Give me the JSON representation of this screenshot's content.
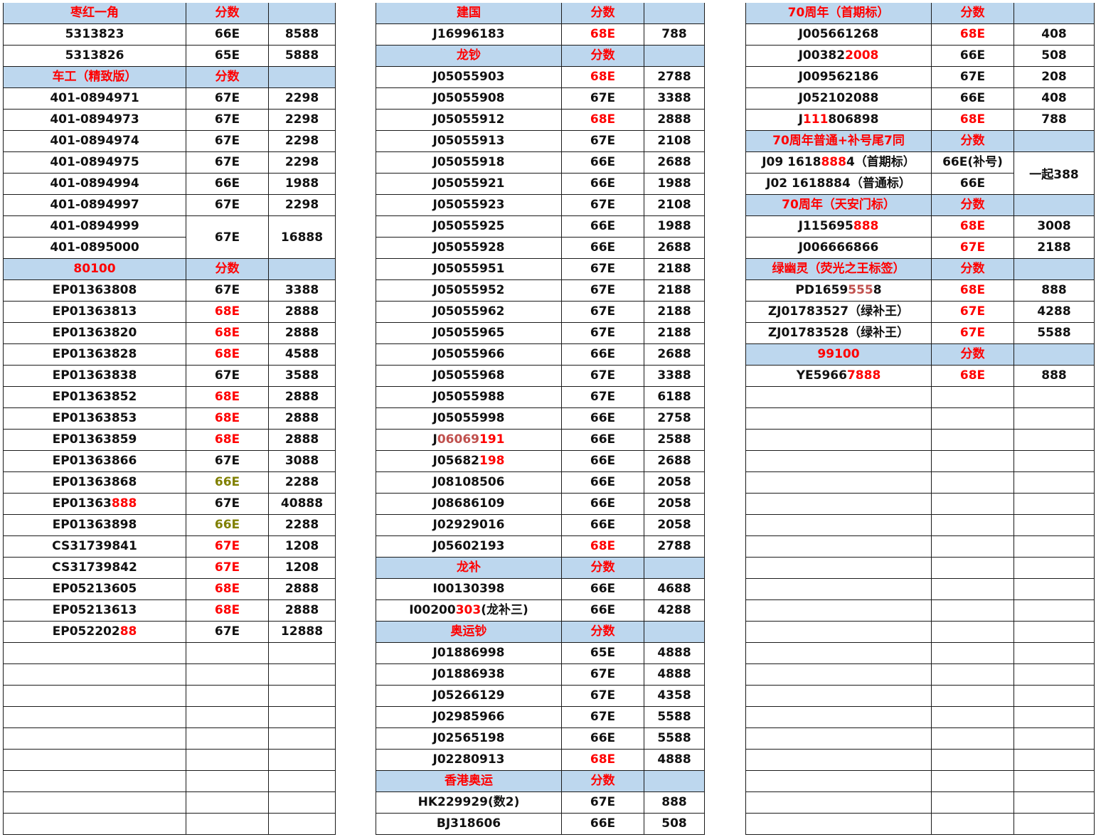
{
  "colors": {
    "header_bg": "#bdd7ee",
    "header_text": "#ff0000",
    "text": "#111111",
    "red": "#ff0000",
    "olive": "#808000",
    "brown": "#c0504d"
  },
  "panels": [
    {
      "id": "panel-1",
      "widths": [
        257,
        116,
        94
      ],
      "rows": [
        {
          "type": "header",
          "cells": [
            "枣红一角",
            "分数",
            ""
          ]
        },
        {
          "cells": [
            "5313823",
            "66E",
            "8588"
          ]
        },
        {
          "cells": [
            "5313826",
            "65E",
            "5888"
          ]
        },
        {
          "type": "header",
          "cells": [
            "车工（精致版）",
            "分数",
            ""
          ]
        },
        {
          "cells": [
            "401-0894971",
            "67E",
            "2298"
          ]
        },
        {
          "cells": [
            "401-0894973",
            "67E",
            "2298"
          ]
        },
        {
          "cells": [
            "401-0894974",
            "67E",
            "2298"
          ]
        },
        {
          "cells": [
            "401-0894975",
            "67E",
            "2298"
          ]
        },
        {
          "cells": [
            "401-0894994",
            "66E",
            "1988"
          ]
        },
        {
          "cells": [
            "401-0894997",
            "67E",
            "2298"
          ]
        },
        {
          "cells": [
            "401-0894999",
            {
              "text": "67E",
              "rowspan": 2
            },
            {
              "text": "16888",
              "rowspan": 2
            }
          ]
        },
        {
          "cells": [
            "401-0895000"
          ]
        },
        {
          "type": "header",
          "cells": [
            "80100",
            "分数",
            ""
          ]
        },
        {
          "cells": [
            "EP01363808",
            "67E",
            "3388"
          ]
        },
        {
          "cells": [
            "EP01363813",
            {
              "text": "68E",
              "color": "red"
            },
            "2888"
          ]
        },
        {
          "cells": [
            "EP01363820",
            {
              "text": "68E",
              "color": "red"
            },
            "2888"
          ]
        },
        {
          "cells": [
            "EP01363828",
            {
              "text": "68E",
              "color": "red"
            },
            "4588"
          ]
        },
        {
          "cells": [
            "EP01363838",
            "67E",
            "3588"
          ]
        },
        {
          "cells": [
            "EP01363852",
            {
              "text": "68E",
              "color": "red"
            },
            "2888"
          ]
        },
        {
          "cells": [
            "EP01363853",
            {
              "text": "68E",
              "color": "red"
            },
            "2888"
          ]
        },
        {
          "cells": [
            "EP01363859",
            {
              "text": "68E",
              "color": "red"
            },
            "2888"
          ]
        },
        {
          "cells": [
            "EP01363866",
            "67E",
            "3088"
          ]
        },
        {
          "cells": [
            "EP01363868",
            {
              "text": "66E",
              "color": "olive"
            },
            "2288"
          ]
        },
        {
          "cells": [
            {
              "parts": [
                [
                  "EP01363",
                  ""
                ],
                [
                  "888",
                  "red"
                ]
              ]
            },
            "67E",
            "40888"
          ]
        },
        {
          "cells": [
            "EP01363898",
            {
              "text": "66E",
              "color": "olive"
            },
            "2288"
          ]
        },
        {
          "cells": [
            "CS31739841",
            {
              "text": "67E",
              "color": "red"
            },
            "1208"
          ]
        },
        {
          "cells": [
            "CS31739842",
            {
              "text": "67E",
              "color": "red"
            },
            "1208"
          ]
        },
        {
          "cells": [
            "EP05213605",
            {
              "text": "68E",
              "color": "red"
            },
            "2888"
          ]
        },
        {
          "cells": [
            "EP05213613",
            {
              "text": "68E",
              "color": "red"
            },
            "2888"
          ]
        },
        {
          "cells": [
            {
              "parts": [
                [
                  "EP052202",
                  ""
                ],
                [
                  "88",
                  "red"
                ]
              ]
            },
            "67E",
            "12888"
          ]
        },
        {
          "cells": [
            "",
            "",
            ""
          ]
        },
        {
          "cells": [
            "",
            "",
            ""
          ]
        },
        {
          "cells": [
            "",
            "",
            ""
          ]
        },
        {
          "cells": [
            "",
            "",
            ""
          ]
        },
        {
          "cells": [
            "",
            "",
            ""
          ]
        },
        {
          "cells": [
            "",
            "",
            ""
          ]
        },
        {
          "cells": [
            "",
            "",
            ""
          ]
        },
        {
          "cells": [
            "",
            "",
            ""
          ]
        },
        {
          "cells": [
            "",
            "",
            ""
          ]
        }
      ]
    },
    {
      "id": "panel-2",
      "widths": [
        261,
        116,
        85
      ],
      "rows": [
        {
          "type": "header",
          "cells": [
            "建国",
            "分数",
            ""
          ]
        },
        {
          "cells": [
            "J16996183",
            {
              "text": "68E",
              "color": "red"
            },
            "788"
          ]
        },
        {
          "type": "header",
          "cells": [
            "龙钞",
            "分数",
            ""
          ]
        },
        {
          "cells": [
            "J05055903",
            {
              "text": "68E",
              "color": "red"
            },
            "2788"
          ]
        },
        {
          "cells": [
            "J05055908",
            "67E",
            "3388"
          ]
        },
        {
          "cells": [
            "J05055912",
            {
              "text": "68E",
              "color": "red"
            },
            "2888"
          ]
        },
        {
          "cells": [
            "J05055913",
            "67E",
            "2108"
          ]
        },
        {
          "cells": [
            "J05055918",
            "66E",
            "2688"
          ]
        },
        {
          "cells": [
            "J05055921",
            "66E",
            "1988"
          ]
        },
        {
          "cells": [
            "J05055923",
            "67E",
            "2108"
          ]
        },
        {
          "cells": [
            "J05055925",
            "66E",
            "1988"
          ]
        },
        {
          "cells": [
            "J05055928",
            "66E",
            "2688"
          ]
        },
        {
          "cells": [
            "J05055951",
            "67E",
            "2188"
          ]
        },
        {
          "cells": [
            "J05055952",
            "67E",
            "2188"
          ]
        },
        {
          "cells": [
            "J05055962",
            "67E",
            "2188"
          ]
        },
        {
          "cells": [
            "J05055965",
            "67E",
            "2188"
          ]
        },
        {
          "cells": [
            "J05055966",
            "66E",
            "2688"
          ]
        },
        {
          "cells": [
            "J05055968",
            "67E",
            "3388"
          ]
        },
        {
          "cells": [
            "J05055988",
            "67E",
            "6188"
          ]
        },
        {
          "cells": [
            "J05055998",
            "66E",
            "2758"
          ]
        },
        {
          "cells": [
            {
              "parts": [
                [
                  "J",
                  ""
                ],
                [
                  "06069",
                  "brown"
                ],
                [
                  "191",
                  "red"
                ]
              ]
            },
            "66E",
            "2588"
          ]
        },
        {
          "cells": [
            {
              "parts": [
                [
                  "J05682",
                  ""
                ],
                [
                  "198",
                  "red"
                ]
              ]
            },
            "66E",
            "2688"
          ]
        },
        {
          "cells": [
            "J08108506",
            "66E",
            "2058"
          ]
        },
        {
          "cells": [
            "J08686109",
            "66E",
            "2058"
          ]
        },
        {
          "cells": [
            "J02929016",
            "66E",
            "2058"
          ]
        },
        {
          "cells": [
            "J05602193",
            {
              "text": "68E",
              "color": "red"
            },
            "2788"
          ]
        },
        {
          "type": "header",
          "cells": [
            "龙补",
            "分数",
            ""
          ]
        },
        {
          "cells": [
            "I00130398",
            "66E",
            "4688"
          ]
        },
        {
          "cells": [
            {
              "parts": [
                [
                  "I00200",
                  ""
                ],
                [
                  "303",
                  "red"
                ],
                [
                  "(龙补三)",
                  ""
                ]
              ]
            },
            "66E",
            "4288"
          ]
        },
        {
          "type": "header",
          "cells": [
            "奥运钞",
            "分数",
            ""
          ]
        },
        {
          "cells": [
            "J01886998",
            "65E",
            "4888"
          ]
        },
        {
          "cells": [
            "J01886938",
            "67E",
            "4888"
          ]
        },
        {
          "cells": [
            "J05266129",
            "67E",
            "4358"
          ]
        },
        {
          "cells": [
            "J02985966",
            "67E",
            "5588"
          ]
        },
        {
          "cells": [
            "J02565198",
            "66E",
            "5588"
          ]
        },
        {
          "cells": [
            "J02280913",
            {
              "text": "68E",
              "color": "red"
            },
            "4888"
          ]
        },
        {
          "type": "header",
          "cells": [
            "香港奥运",
            "分数",
            ""
          ]
        },
        {
          "cells": [
            "HK229929(数2)",
            "67E",
            "888"
          ]
        },
        {
          "cells": [
            "BJ318606",
            "66E",
            "508"
          ]
        }
      ]
    },
    {
      "id": "panel-3",
      "widths": [
        261,
        116,
        113
      ],
      "rows": [
        {
          "type": "header",
          "cells": [
            "70周年（首期标）",
            "分数",
            ""
          ]
        },
        {
          "cells": [
            "J005661268",
            {
              "text": "68E",
              "color": "red"
            },
            "408"
          ]
        },
        {
          "cells": [
            {
              "parts": [
                [
                  "J00382",
                  ""
                ],
                [
                  "2008",
                  "red"
                ]
              ]
            },
            "66E",
            "508"
          ]
        },
        {
          "cells": [
            "J009562186",
            "67E",
            "208"
          ]
        },
        {
          "cells": [
            "J052102088",
            "66E",
            "408"
          ]
        },
        {
          "cells": [
            {
              "parts": [
                [
                  "J",
                  ""
                ],
                [
                  "111",
                  "red"
                ],
                [
                  "806898",
                  ""
                ]
              ]
            },
            {
              "text": "68E",
              "color": "red"
            },
            "788"
          ]
        },
        {
          "type": "header",
          "cells": [
            "70周年普通+补号尾7同",
            "分数",
            ""
          ]
        },
        {
          "cells": [
            {
              "parts": [
                [
                  "J09 1618",
                  ""
                ],
                [
                  "888",
                  "red"
                ],
                [
                  "4（首期标）",
                  ""
                ]
              ]
            },
            "66E(补号)",
            {
              "text": "一起388",
              "rowspan": 2
            }
          ]
        },
        {
          "cells": [
            "J02 1618884（普通标）",
            "66E"
          ]
        },
        {
          "type": "header",
          "cells": [
            "70周年（天安门标）",
            "分数",
            ""
          ]
        },
        {
          "cells": [
            {
              "parts": [
                [
                  "J115695",
                  ""
                ],
                [
                  "888",
                  "red"
                ]
              ]
            },
            {
              "text": "68E",
              "color": "red"
            },
            "3008"
          ]
        },
        {
          "cells": [
            "J006666866",
            {
              "text": "67E",
              "color": "red"
            },
            "2188"
          ]
        },
        {
          "type": "header",
          "cells": [
            "绿幽灵（荧光之王标签）",
            "分数",
            ""
          ]
        },
        {
          "cells": [
            {
              "parts": [
                [
                  "PD1659",
                  ""
                ],
                [
                  "555",
                  "brown"
                ],
                [
                  "8",
                  ""
                ]
              ]
            },
            {
              "text": "68E",
              "color": "red"
            },
            "888"
          ]
        },
        {
          "cells": [
            "ZJ01783527（绿补王）",
            {
              "text": "67E",
              "color": "red"
            },
            "4288"
          ]
        },
        {
          "cells": [
            "ZJ01783528（绿补王）",
            {
              "text": "67E",
              "color": "red"
            },
            "5588"
          ]
        },
        {
          "type": "header",
          "cells": [
            "99100",
            "分数",
            ""
          ]
        },
        {
          "cells": [
            {
              "parts": [
                [
                  "YE5966",
                  ""
                ],
                [
                  "7888",
                  "red"
                ]
              ]
            },
            {
              "text": "68E",
              "color": "red"
            },
            "888"
          ]
        },
        {
          "cells": [
            "",
            "",
            ""
          ]
        },
        {
          "cells": [
            "",
            "",
            ""
          ]
        },
        {
          "cells": [
            "",
            "",
            ""
          ]
        },
        {
          "cells": [
            "",
            "",
            ""
          ]
        },
        {
          "cells": [
            "",
            "",
            ""
          ]
        },
        {
          "cells": [
            "",
            "",
            ""
          ]
        },
        {
          "cells": [
            "",
            "",
            ""
          ]
        },
        {
          "cells": [
            "",
            "",
            ""
          ]
        },
        {
          "cells": [
            "",
            "",
            ""
          ]
        },
        {
          "cells": [
            "",
            "",
            ""
          ]
        },
        {
          "cells": [
            "",
            "",
            ""
          ]
        },
        {
          "cells": [
            "",
            "",
            ""
          ]
        },
        {
          "cells": [
            "",
            "",
            ""
          ]
        },
        {
          "cells": [
            "",
            "",
            ""
          ]
        },
        {
          "cells": [
            "",
            "",
            ""
          ]
        },
        {
          "cells": [
            "",
            "",
            ""
          ]
        },
        {
          "cells": [
            "",
            "",
            ""
          ]
        },
        {
          "cells": [
            "",
            "",
            ""
          ]
        },
        {
          "cells": [
            "",
            "",
            ""
          ]
        },
        {
          "cells": [
            "",
            "",
            ""
          ]
        },
        {
          "cells": [
            "",
            "",
            ""
          ]
        }
      ]
    }
  ]
}
